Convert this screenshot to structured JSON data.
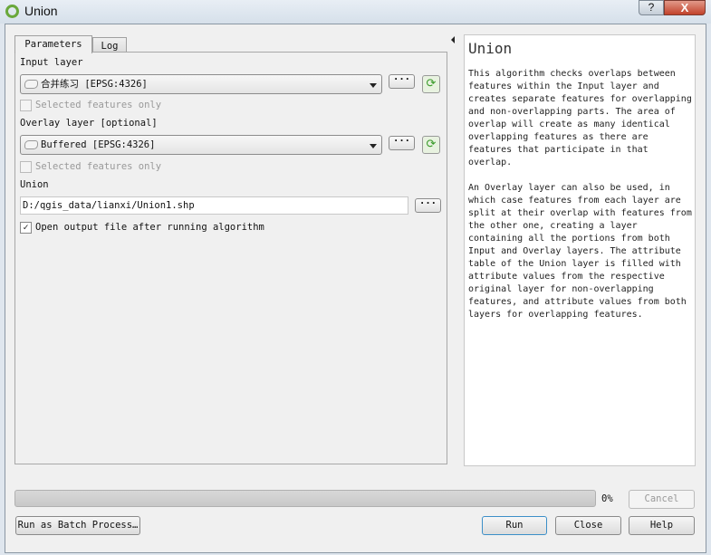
{
  "window": {
    "title": "Union",
    "help": "?",
    "close": "X"
  },
  "tabs": [
    {
      "label": "Parameters",
      "active": true
    },
    {
      "label": "Log",
      "active": false
    }
  ],
  "params": {
    "input_label": "Input layer",
    "input_value": "合并练习 [EPSG:4326]",
    "input_selected": "Selected features only",
    "overlay_label": "Overlay layer [optional]",
    "overlay_value": "Buffered [EPSG:4326]",
    "overlay_selected": "Selected features only",
    "output_label": "Union",
    "output_value": "D:/qgis_data/lianxi/Union1.shp",
    "open_output": "Open output file after running algorithm",
    "open_output_checked": true,
    "browse": "···"
  },
  "help": {
    "title": "Union",
    "para1": [
      "This algorithm checks overlaps between",
      "features within the Input layer and",
      "creates separate features for overlapping",
      "and non-overlapping parts. The area of",
      "overlap will create as many identical",
      "overlapping features as there are",
      "features that participate in that",
      "overlap."
    ],
    "para2": [
      "An Overlay layer can also be used, in",
      "which case features from each layer are",
      "split at their overlap with features from",
      "the other one, creating a layer",
      "containing all the portions from both",
      "Input and Overlay layers. The attribute",
      "table of the Union layer is filled with",
      "attribute values from the respective",
      "original layer for non-overlapping",
      "features, and attribute values from both",
      "layers for overlapping features."
    ]
  },
  "footer": {
    "progress": "0%",
    "progress_value": 0,
    "cancel": "Cancel",
    "batch": "Run as Batch Process…",
    "run": "Run",
    "close": "Close",
    "help": "Help"
  }
}
